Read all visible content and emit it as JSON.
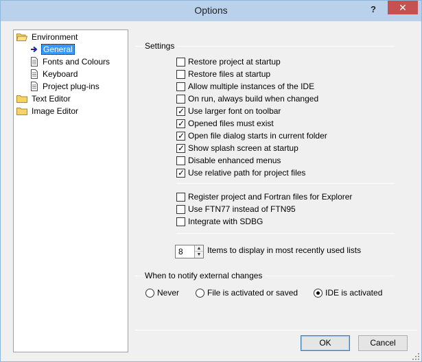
{
  "window": {
    "title": "Options",
    "help_label": "?",
    "close_label": "✕"
  },
  "tree": {
    "environment": "Environment",
    "general": "General",
    "fonts_colours": "Fonts and Colours",
    "keyboard": "Keyboard",
    "project_plugins": "Project plug-ins",
    "text_editor": "Text Editor",
    "image_editor": "Image Editor"
  },
  "settings": {
    "group_label": "Settings",
    "checkboxes": [
      {
        "label": "Restore project at startup",
        "checked": false
      },
      {
        "label": "Restore files at startup",
        "checked": false
      },
      {
        "label": "Allow multiple instances of the IDE",
        "checked": false
      },
      {
        "label": "On run, always build when changed",
        "checked": false
      },
      {
        "label": "Use larger font on toolbar",
        "checked": true
      },
      {
        "label": "Opened files must exist",
        "checked": true
      },
      {
        "label": "Open file dialog starts in current folder",
        "checked": true
      },
      {
        "label": "Show splash screen at startup",
        "checked": true
      },
      {
        "label": "Disable enhanced menus",
        "checked": false
      },
      {
        "label": "Use relative path for project files",
        "checked": true
      }
    ],
    "checkboxes2": [
      {
        "label": "Register project and Fortran files for Explorer",
        "checked": false
      },
      {
        "label": "Use FTN77 instead of FTN95",
        "checked": false
      },
      {
        "label": "Integrate with SDBG",
        "checked": false
      }
    ],
    "mru_value": "8",
    "mru_label": "Items to display in most recently used lists"
  },
  "notify": {
    "group_label": "When to notify external changes",
    "options": [
      {
        "label": "Never",
        "selected": false
      },
      {
        "label": "File is activated or saved",
        "selected": false
      },
      {
        "label": "IDE is activated",
        "selected": true
      }
    ]
  },
  "buttons": {
    "ok": "OK",
    "cancel": "Cancel"
  },
  "icons": {
    "folder": "folder-icon",
    "page": "page-icon",
    "arrow": "arrow-right-icon"
  }
}
